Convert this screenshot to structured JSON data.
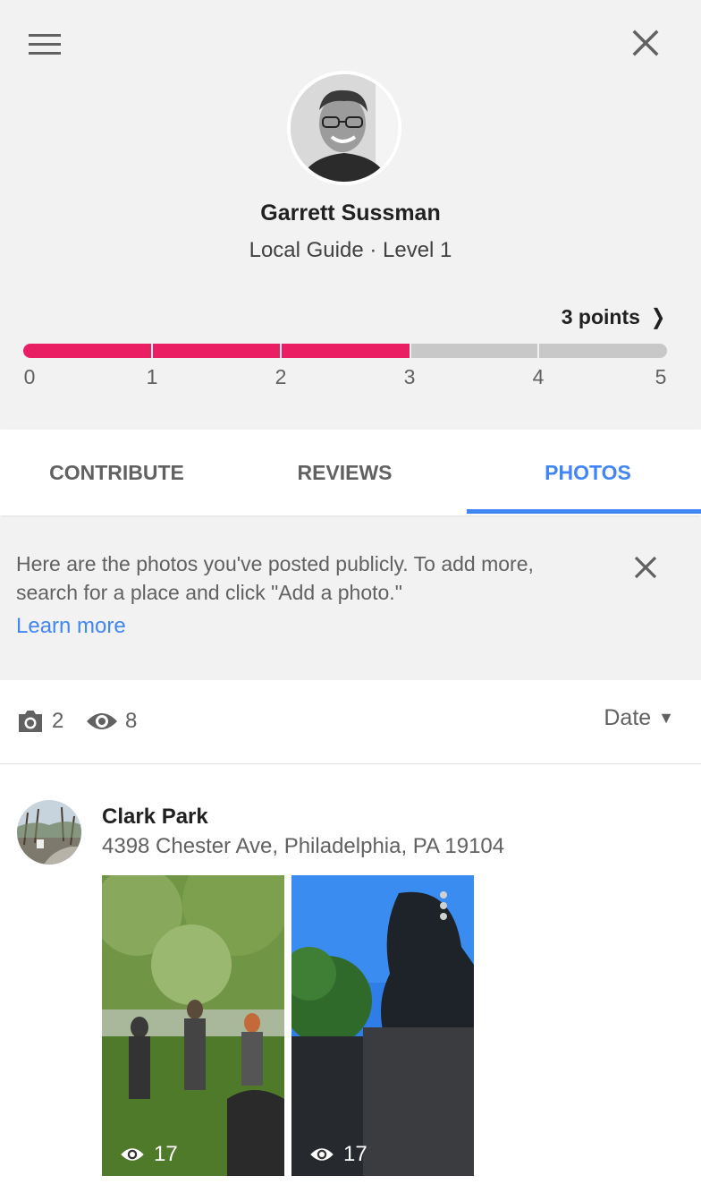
{
  "profile": {
    "name": "Garrett Sussman",
    "level_text": "Local Guide · Level 1",
    "points_label": "3 points",
    "progress_points": 3,
    "progress_max": 5,
    "ticks": [
      "0",
      "1",
      "2",
      "3",
      "4",
      "5"
    ]
  },
  "tabs": [
    {
      "label": "CONTRIBUTE",
      "active": false
    },
    {
      "label": "REVIEWS",
      "active": false
    },
    {
      "label": "PHOTOS",
      "active": true
    }
  ],
  "notice": {
    "text": "Here are the photos you've posted publicly. To add more, search for a place and click \"Add a photo.\"",
    "link": "Learn more"
  },
  "stats": {
    "photo_count": "2",
    "view_count": "8",
    "sort_label": "Date"
  },
  "places": [
    {
      "name": "Clark Park",
      "address": "4398 Chester Ave, Philadelphia, PA 19104",
      "photos": [
        {
          "views": "17"
        },
        {
          "views": "17"
        }
      ]
    }
  ],
  "colors": {
    "accent_blue": "#4285f4",
    "progress_pink": "#e91e63",
    "progress_gray": "#c8c8c8",
    "header_bg": "#f2f2f2"
  },
  "icons": {
    "menu": "hamburger-menu-icon",
    "close": "close-icon",
    "camera": "camera-icon",
    "eye": "eye-icon",
    "chevron": "chevron-right-icon",
    "caret": "caret-down-icon"
  }
}
